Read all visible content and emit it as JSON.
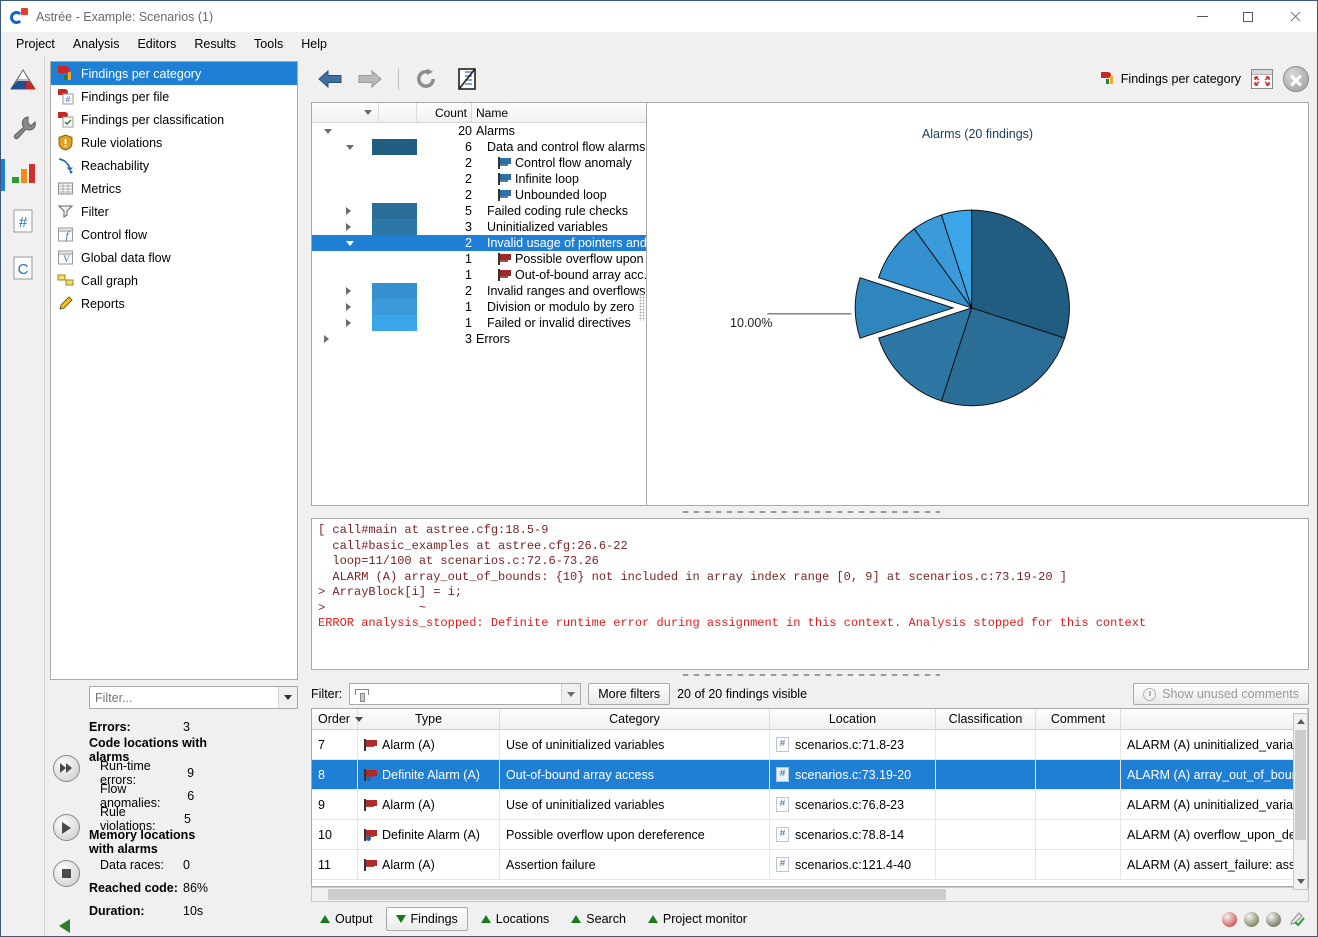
{
  "window": {
    "title": "Astrée - Example: Scenarios (1)",
    "minimize": "—",
    "maximize": "□",
    "close": "✕"
  },
  "menubar": {
    "items": [
      "Project",
      "Analysis",
      "Editors",
      "Results",
      "Tools",
      "Help"
    ]
  },
  "rail": {
    "items": [
      {
        "name": "project-icon",
        "label": "Project"
      },
      {
        "name": "settings-wrench-icon",
        "label": "Settings"
      },
      {
        "name": "results-chart-icon",
        "label": "Results",
        "selected": true
      },
      {
        "name": "metrics-hash-icon",
        "label": "Metrics"
      },
      {
        "name": "c-code-icon",
        "label": "C Code"
      }
    ]
  },
  "sidebar": {
    "items": [
      {
        "label": "Findings per category",
        "icon": "findings-category-icon",
        "selected": true
      },
      {
        "label": "Findings per file",
        "icon": "findings-file-icon",
        "selected": false
      },
      {
        "label": "Findings per classification",
        "icon": "findings-classification-icon",
        "selected": false
      },
      {
        "label": "Rule violations",
        "icon": "rule-violations-shield-icon",
        "selected": false
      },
      {
        "label": "Reachability",
        "icon": "reachability-arrow-icon",
        "selected": false
      },
      {
        "label": "Metrics",
        "icon": "metrics-table-icon",
        "selected": false
      },
      {
        "label": "Filter",
        "icon": "filter-funnel-icon",
        "selected": false
      },
      {
        "label": "Control flow",
        "icon": "control-flow-icon",
        "selected": false
      },
      {
        "label": "Global data flow",
        "icon": "global-data-flow-icon",
        "selected": false
      },
      {
        "label": "Call graph",
        "icon": "call-graph-icon",
        "selected": false
      },
      {
        "label": "Reports",
        "icon": "reports-pencil-icon",
        "selected": false
      }
    ],
    "filter_placeholder": "Filter...",
    "stats": [
      {
        "key": "Errors:",
        "value": "3",
        "bold": true,
        "sub": false
      },
      {
        "key": "Code locations with alarms",
        "value": "",
        "bold": true,
        "sub": false
      },
      {
        "key": "Run-time errors:",
        "value": "9",
        "bold": false,
        "sub": true
      },
      {
        "key": "Flow anomalies:",
        "value": "6",
        "bold": false,
        "sub": true
      },
      {
        "key": "Rule violations:",
        "value": "5",
        "bold": false,
        "sub": true
      },
      {
        "key": "Memory locations with alarms",
        "value": "",
        "bold": true,
        "sub": false
      },
      {
        "key": "Data races:",
        "value": "0",
        "bold": false,
        "sub": true
      },
      {
        "key": "Reached code:",
        "value": "86%",
        "bold": true,
        "sub": false
      },
      {
        "key": "Duration:",
        "value": "10s",
        "bold": true,
        "sub": false
      }
    ]
  },
  "toolbar": {
    "back": "back-arrow",
    "forward": "forward-arrow",
    "reload": "reload-arrow",
    "report": "report-clipboard",
    "view_label": "Findings per category",
    "maximize_label": "Maximize view",
    "close_label": "Close view"
  },
  "tree": {
    "headers": [
      "",
      "",
      "Count",
      "Name"
    ],
    "rows": [
      {
        "count": "20",
        "name": "Alarms",
        "indent": 0,
        "expander": "open",
        "swatch": "",
        "flag": ""
      },
      {
        "count": "6",
        "name": "Data and control flow alarms",
        "indent": 1,
        "expander": "open",
        "swatch": "#215d80",
        "flag": ""
      },
      {
        "count": "2",
        "name": "Control flow anomaly",
        "indent": 2,
        "expander": "",
        "swatch": "",
        "flag": "#2f6fa8"
      },
      {
        "count": "2",
        "name": "Infinite loop",
        "indent": 2,
        "expander": "",
        "swatch": "",
        "flag": "#2f6fa8"
      },
      {
        "count": "2",
        "name": "Unbounded loop",
        "indent": 2,
        "expander": "",
        "swatch": "",
        "flag": "#2f6fa8"
      },
      {
        "count": "5",
        "name": "Failed coding rule checks",
        "indent": 1,
        "expander": "closed",
        "swatch": "#2a6d96",
        "flag": ""
      },
      {
        "count": "3",
        "name": "Uninitialized variables",
        "indent": 1,
        "expander": "closed",
        "swatch": "#2d77a5",
        "flag": ""
      },
      {
        "count": "2",
        "name": "Invalid usage of pointers and...",
        "indent": 1,
        "expander": "open",
        "swatch": "",
        "flag": "",
        "selected": true
      },
      {
        "count": "1",
        "name": "Possible overflow upon ...",
        "indent": 2,
        "expander": "",
        "swatch": "",
        "flag": "#9c2a2a"
      },
      {
        "count": "1",
        "name": "Out-of-bound array acc...",
        "indent": 2,
        "expander": "",
        "swatch": "",
        "flag": "#9c2a2a"
      },
      {
        "count": "2",
        "name": "Invalid ranges and overflows",
        "indent": 1,
        "expander": "closed",
        "swatch": "#3490cf",
        "flag": ""
      },
      {
        "count": "1",
        "name": "Division or modulo by zero",
        "indent": 1,
        "expander": "closed",
        "swatch": "#3a9ada",
        "flag": ""
      },
      {
        "count": "1",
        "name": "Failed or invalid directives",
        "indent": 1,
        "expander": "closed",
        "swatch": "#3aa5e8",
        "flag": ""
      },
      {
        "count": "3",
        "name": "Errors",
        "indent": 0,
        "expander": "closed",
        "swatch": "",
        "flag": ""
      }
    ]
  },
  "chart_data": {
    "type": "pie",
    "title": "Alarms (20 findings)",
    "total": 20,
    "unit": "findings",
    "grid": false,
    "legend_position": "none",
    "annotations": [
      "10.00%"
    ],
    "labels": [
      "Data and control flow alarms",
      "Failed coding rule checks",
      "Uninitialized variables",
      "Invalid usage of pointers and dereferencing",
      "Invalid ranges and overflows",
      "Division or modulo by zero",
      "Failed or invalid directives"
    ],
    "values": [
      6,
      5,
      3,
      2,
      2,
      1,
      1
    ],
    "percentages": [
      "30.00%",
      "25.00%",
      "15.00%",
      "10.00%",
      "10.00%",
      "5.00%",
      "5.00%"
    ],
    "colors": [
      "#215d80",
      "#2a6d96",
      "#2d77a5",
      "#2f86bd",
      "#3490cf",
      "#3a9ada",
      "#3aa5e8"
    ],
    "exploded_slice": "Invalid usage of pointers and dereferencing",
    "exploded_label": "10.00%"
  },
  "code_output": {
    "lines": [
      {
        "text": "[ call#main at astree.cfg:18.5-9",
        "error": false
      },
      {
        "text": "  call#basic_examples at astree.cfg:26.6-22",
        "error": false
      },
      {
        "text": "  loop=11/100 at scenarios.c:72.6-73.26",
        "error": false
      },
      {
        "text": "  ALARM (A) array_out_of_bounds: {10} not included in array index range [0, 9] at scenarios.c:73.19-20 ]",
        "error": false
      },
      {
        "text": "> ArrayBlock[i] = i;",
        "error": false
      },
      {
        "text": ">             ~",
        "error": false
      },
      {
        "text": "ERROR analysis_stopped: Definite runtime error during assignment in this context. Analysis stopped for this context",
        "error": true
      }
    ]
  },
  "findings_filter": {
    "label": "Filter:",
    "input_value": "",
    "more_filters": "More filters",
    "visible_text": "20 of 20 findings visible",
    "show_unused_comments": "Show unused comments"
  },
  "findings_table": {
    "headers": [
      "Order",
      "Type",
      "Category",
      "Location",
      "Classification",
      "Comment",
      ""
    ],
    "sort_column": "Order",
    "rows": [
      {
        "order": "7",
        "type": "Alarm (A)",
        "type_icon": "alarm-flag-icon",
        "category": "Use of uninitialized variables",
        "location": "scenarios.c:71.8-23",
        "classification": "",
        "comment": "",
        "text": "ALARM (A) uninitialized_variable",
        "selected": false
      },
      {
        "order": "8",
        "type": "Definite Alarm (A)",
        "type_icon": "definite-alarm-flag-icon",
        "category": "Out-of-bound array access",
        "location": "scenarios.c:73.19-20",
        "classification": "",
        "comment": "",
        "text": "ALARM (A) array_out_of_bounds",
        "selected": true
      },
      {
        "order": "9",
        "type": "Alarm (A)",
        "type_icon": "alarm-flag-icon",
        "category": "Use of uninitialized variables",
        "location": "scenarios.c:76.8-23",
        "classification": "",
        "comment": "",
        "text": "ALARM (A) uninitialized_variable",
        "selected": false
      },
      {
        "order": "10",
        "type": "Definite Alarm (A)",
        "type_icon": "definite-alarm-flag-icon",
        "category": "Possible overflow upon dereference",
        "location": "scenarios.c:78.8-14",
        "classification": "",
        "comment": "",
        "text": "ALARM (A) overflow_upon_deref",
        "selected": false
      },
      {
        "order": "11",
        "type": "Alarm (A)",
        "type_icon": "alarm-flag-icon",
        "category": "Assertion failure",
        "location": "scenarios.c:121.4-40",
        "classification": "",
        "comment": "",
        "text": "ALARM (A) assert_failure: assertio",
        "selected": false
      }
    ]
  },
  "bottom_tabs": {
    "tabs": [
      {
        "label": "Output",
        "active": false,
        "arrow": "up"
      },
      {
        "label": "Findings",
        "active": true,
        "arrow": "down"
      },
      {
        "label": "Locations",
        "active": false,
        "arrow": "up"
      },
      {
        "label": "Search",
        "active": false,
        "arrow": "up"
      },
      {
        "label": "Project monitor",
        "active": false,
        "arrow": "up"
      }
    ],
    "leds": [
      {
        "name": "led-red",
        "color": "#cc2222"
      },
      {
        "name": "led-olive-1",
        "color": "#5a6030"
      },
      {
        "name": "led-olive-2",
        "color": "#4a5530"
      }
    ],
    "check_icon": "check-pencil-icon"
  },
  "colors": {
    "accent": "#1f7fd4",
    "title_blue": "#1a3b5c",
    "error_red": "#e01b1b",
    "code_maroon": "#7b1f1f"
  }
}
